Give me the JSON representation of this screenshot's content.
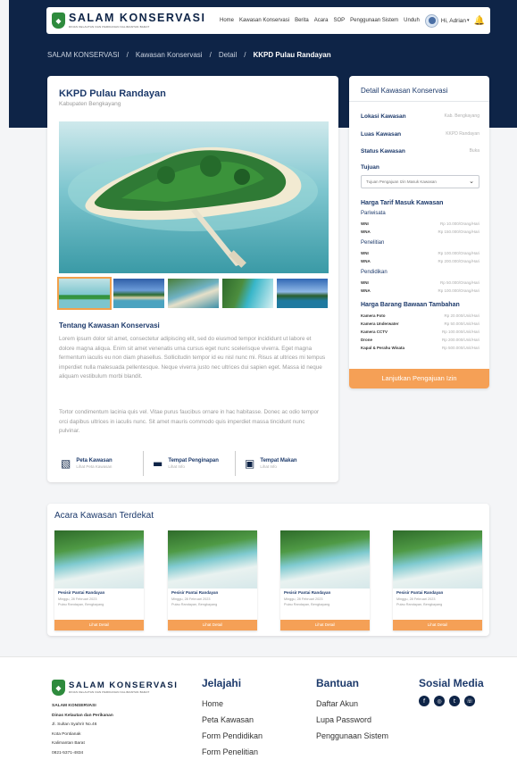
{
  "header": {
    "brand": "SALAM KONSERVASI",
    "brand_sub": "DINAS KELAUTAN DAN PERIKANAN KALIMANTAN BARAT",
    "nav": [
      "Home",
      "Kawasan Konservasi",
      "Berita",
      "Acara",
      "SOP",
      "Penggunaan Sistem",
      "Unduh"
    ],
    "user_greeting": "Hi, Adrian",
    "icons": {
      "logo": "fish-logo-icon",
      "bell": "bell-icon",
      "avatar": "user-avatar"
    }
  },
  "breadcrumb": [
    "SALAM KONSERVASI",
    "Kawasan Konservasi",
    "Detail",
    "KKPD Pulau Randayan"
  ],
  "main": {
    "title": "KKPD Pulau Randayan",
    "subtitle": "Kabupaten Bengkayang",
    "about_title": "Tentang Kawasan Konservasi",
    "para1": "Lorem ipsum dolor sit amet, consectetur adipiscing elit, sed do eiusmod tempor incididunt ut labore et dolore magna aliqua. Enim sit amet venenatis urna cursus eget nunc scelerisque viverra. Eget magna fermentum iaculis eu non diam phasellus. Sollicitudin tempor id eu nisl nunc mi. Risus at ultrices mi tempus imperdiet nulla malesuada pellentesque. Neque viverra justo nec ultrices dui sapien eget. Massa id neque aliquam vestibulum morbi blandit.",
    "para2": "Tortor condimentum lacinia quis vel. Vitae purus faucibus ornare in hac habitasse. Donec ac odio tempor orci dapibus ultrices in iaculis nunc. Sit amet mauris commodo quis imperdiet massa tincidunt nunc pulvinar.",
    "info": [
      {
        "label": "Peta Kawasan",
        "sub": "Lihat Peta Kawasan",
        "icon": "map-icon"
      },
      {
        "label": "Tempat Penginapan",
        "sub": "Lihat Info",
        "icon": "bed-icon"
      },
      {
        "label": "Tempat Makan",
        "sub": "Lihat Info",
        "icon": "restaurant-icon"
      }
    ]
  },
  "side": {
    "title": "Detail Kawasan Konservasi",
    "rows": [
      {
        "k": "Lokasi Kawasan",
        "v": "Kab. Bengkayang"
      },
      {
        "k": "Luas Kawasan",
        "v": "KKPD Randayan"
      },
      {
        "k": "Status Kawasan",
        "v": "Buka"
      }
    ],
    "tujuan_label": "Tujuan",
    "tujuan_value": "Tujuan Pengajuan Izin Masuk Kawasan",
    "tarif_title": "Harga Tarif Masuk Kawasan",
    "pariwisata": "Pariwisata",
    "pariwisata_rows": [
      {
        "k": "WNI",
        "v": "Rp 10.000/Orang/Hari"
      },
      {
        "k": "WNA",
        "v": "Rp 150.000/Orang/Hari"
      }
    ],
    "penelitian": "Penelitian",
    "penelitian_rows": [
      {
        "k": "WNI",
        "v": "Rp 100.000/Orang/Hari"
      },
      {
        "k": "WNA",
        "v": "Rp 200.000/Orang/Hari"
      }
    ],
    "pendidikan": "Pendidikan",
    "pendidikan_rows": [
      {
        "k": "WNI",
        "v": "Rp 50.000/Orang/Hari"
      },
      {
        "k": "WNA",
        "v": "Rp 100.000/Orang/Hari"
      }
    ],
    "barang_title": "Harga Barang Bawaan Tambahan",
    "barang_rows": [
      {
        "k": "Kamera Foto",
        "v": "Rp 20.000/Unit/Hari"
      },
      {
        "k": "Kamera Underwater",
        "v": "Rp 50.000/Unit/Hari"
      },
      {
        "k": "Kamera CCTV",
        "v": "Rp 100.000/Unit/Hari"
      },
      {
        "k": "Drone",
        "v": "Rp 200.000/Unit/Hari"
      },
      {
        "k": "Kapal & Perahu Wisata",
        "v": "Rp 500.000/Unit/Hari"
      }
    ],
    "cta": "Lanjutkan Pengajuan Izin"
  },
  "events": {
    "title": "Acara Kawasan Terdekat",
    "cards": [
      {
        "name": "Pesisir Pantai Randayan",
        "date": "Minggu, 28 Februari 2023",
        "place": "Pulau Randayan, Bengkayang",
        "btn": "Lihat Detail"
      },
      {
        "name": "Pesisir Pantai Randayan",
        "date": "Minggu, 28 Februari 2023",
        "place": "Pulau Randayan, Bengkayang",
        "btn": "Lihat Detail"
      },
      {
        "name": "Pesisir Pantai Randayan",
        "date": "Minggu, 28 Februari 2023",
        "place": "Pulau Randayan, Bengkayang",
        "btn": "Lihat Detail"
      },
      {
        "name": "Pesisir Pantai Randayan",
        "date": "Minggu, 28 Februari 2023",
        "place": "Pulau Randayan, Bengkayang",
        "btn": "Lihat Detail"
      }
    ]
  },
  "footer": {
    "addr": [
      "SALAM KONSERVASI",
      "Dinas Kelautan dan Perikanan",
      "Jl. Sultan Syahrir No.46",
      "Kota Pontianak",
      "Kalimantan Barat",
      "0821-5371-4834"
    ],
    "jelajahi": {
      "title": "Jelajahi",
      "links": [
        "Home",
        "Peta Kawasan",
        "Form Pendidikan",
        "Form Penelitian"
      ]
    },
    "bantuan": {
      "title": "Bantuan",
      "links": [
        "Daftar Akun",
        "Lupa Password",
        "Penggunaan Sistem"
      ]
    },
    "sosial": {
      "title": "Sosial Media",
      "icons": [
        "facebook-icon",
        "instagram-icon",
        "twitter-icon",
        "whatsapp-icon"
      ]
    }
  },
  "colors": {
    "navy": "#0e2447",
    "accent": "#f5a056",
    "brand_green": "#2e8b3d"
  }
}
